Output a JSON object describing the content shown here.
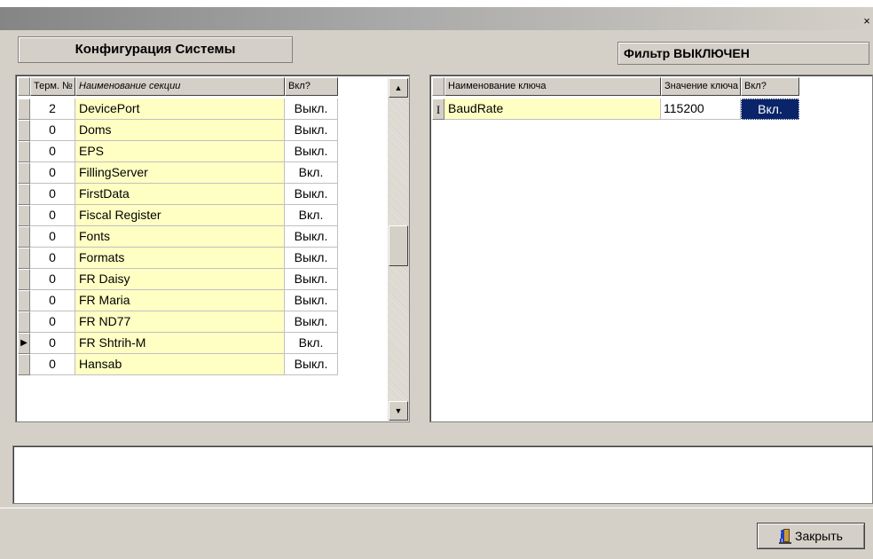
{
  "window": {
    "close_glyph": "×"
  },
  "left_panel": {
    "title": "Конфигурация Системы",
    "columns": [
      "Терм. №",
      "Наименование секции",
      "Вкл?"
    ],
    "rows": [
      {
        "term": "2",
        "section": "DevicePort",
        "enabled": "Выкл."
      },
      {
        "term": "0",
        "section": "Doms",
        "enabled": "Выкл."
      },
      {
        "term": "0",
        "section": "EPS",
        "enabled": "Выкл."
      },
      {
        "term": "0",
        "section": "FillingServer",
        "enabled": "Вкл."
      },
      {
        "term": "0",
        "section": "FirstData",
        "enabled": "Выкл."
      },
      {
        "term": "0",
        "section": "Fiscal Register",
        "enabled": "Вкл."
      },
      {
        "term": "0",
        "section": "Fonts",
        "enabled": "Выкл."
      },
      {
        "term": "0",
        "section": "Formats",
        "enabled": "Выкл."
      },
      {
        "term": "0",
        "section": "FR Daisy",
        "enabled": "Выкл."
      },
      {
        "term": "0",
        "section": "FR Maria",
        "enabled": "Выкл."
      },
      {
        "term": "0",
        "section": "FR ND77",
        "enabled": "Выкл."
      },
      {
        "term": "0",
        "section": "FR Shtrih-M",
        "enabled": "Вкл."
      },
      {
        "term": "0",
        "section": "Hansab",
        "enabled": "Выкл."
      }
    ],
    "current_row_index": 11
  },
  "right_panel": {
    "filter_title": "Фильтр ВЫКЛЮЧЕН",
    "columns": [
      "Наименование ключа",
      "Значение ключа",
      "Вкл?"
    ],
    "rows": [
      {
        "key": "BaudRate",
        "value": "115200",
        "enabled": "Вкл."
      }
    ],
    "row_indicator": "I"
  },
  "footer": {
    "close_label": "Закрыть"
  },
  "icons": [
    "close-icon",
    "scroll-up-arrow-icon",
    "scroll-down-arrow-icon",
    "current-row-arrow-icon",
    "door-exit-icon"
  ],
  "colors": {
    "row_highlight": "#ffffc4",
    "selection": "#0a246a",
    "window_bg": "#d4d0c8"
  }
}
